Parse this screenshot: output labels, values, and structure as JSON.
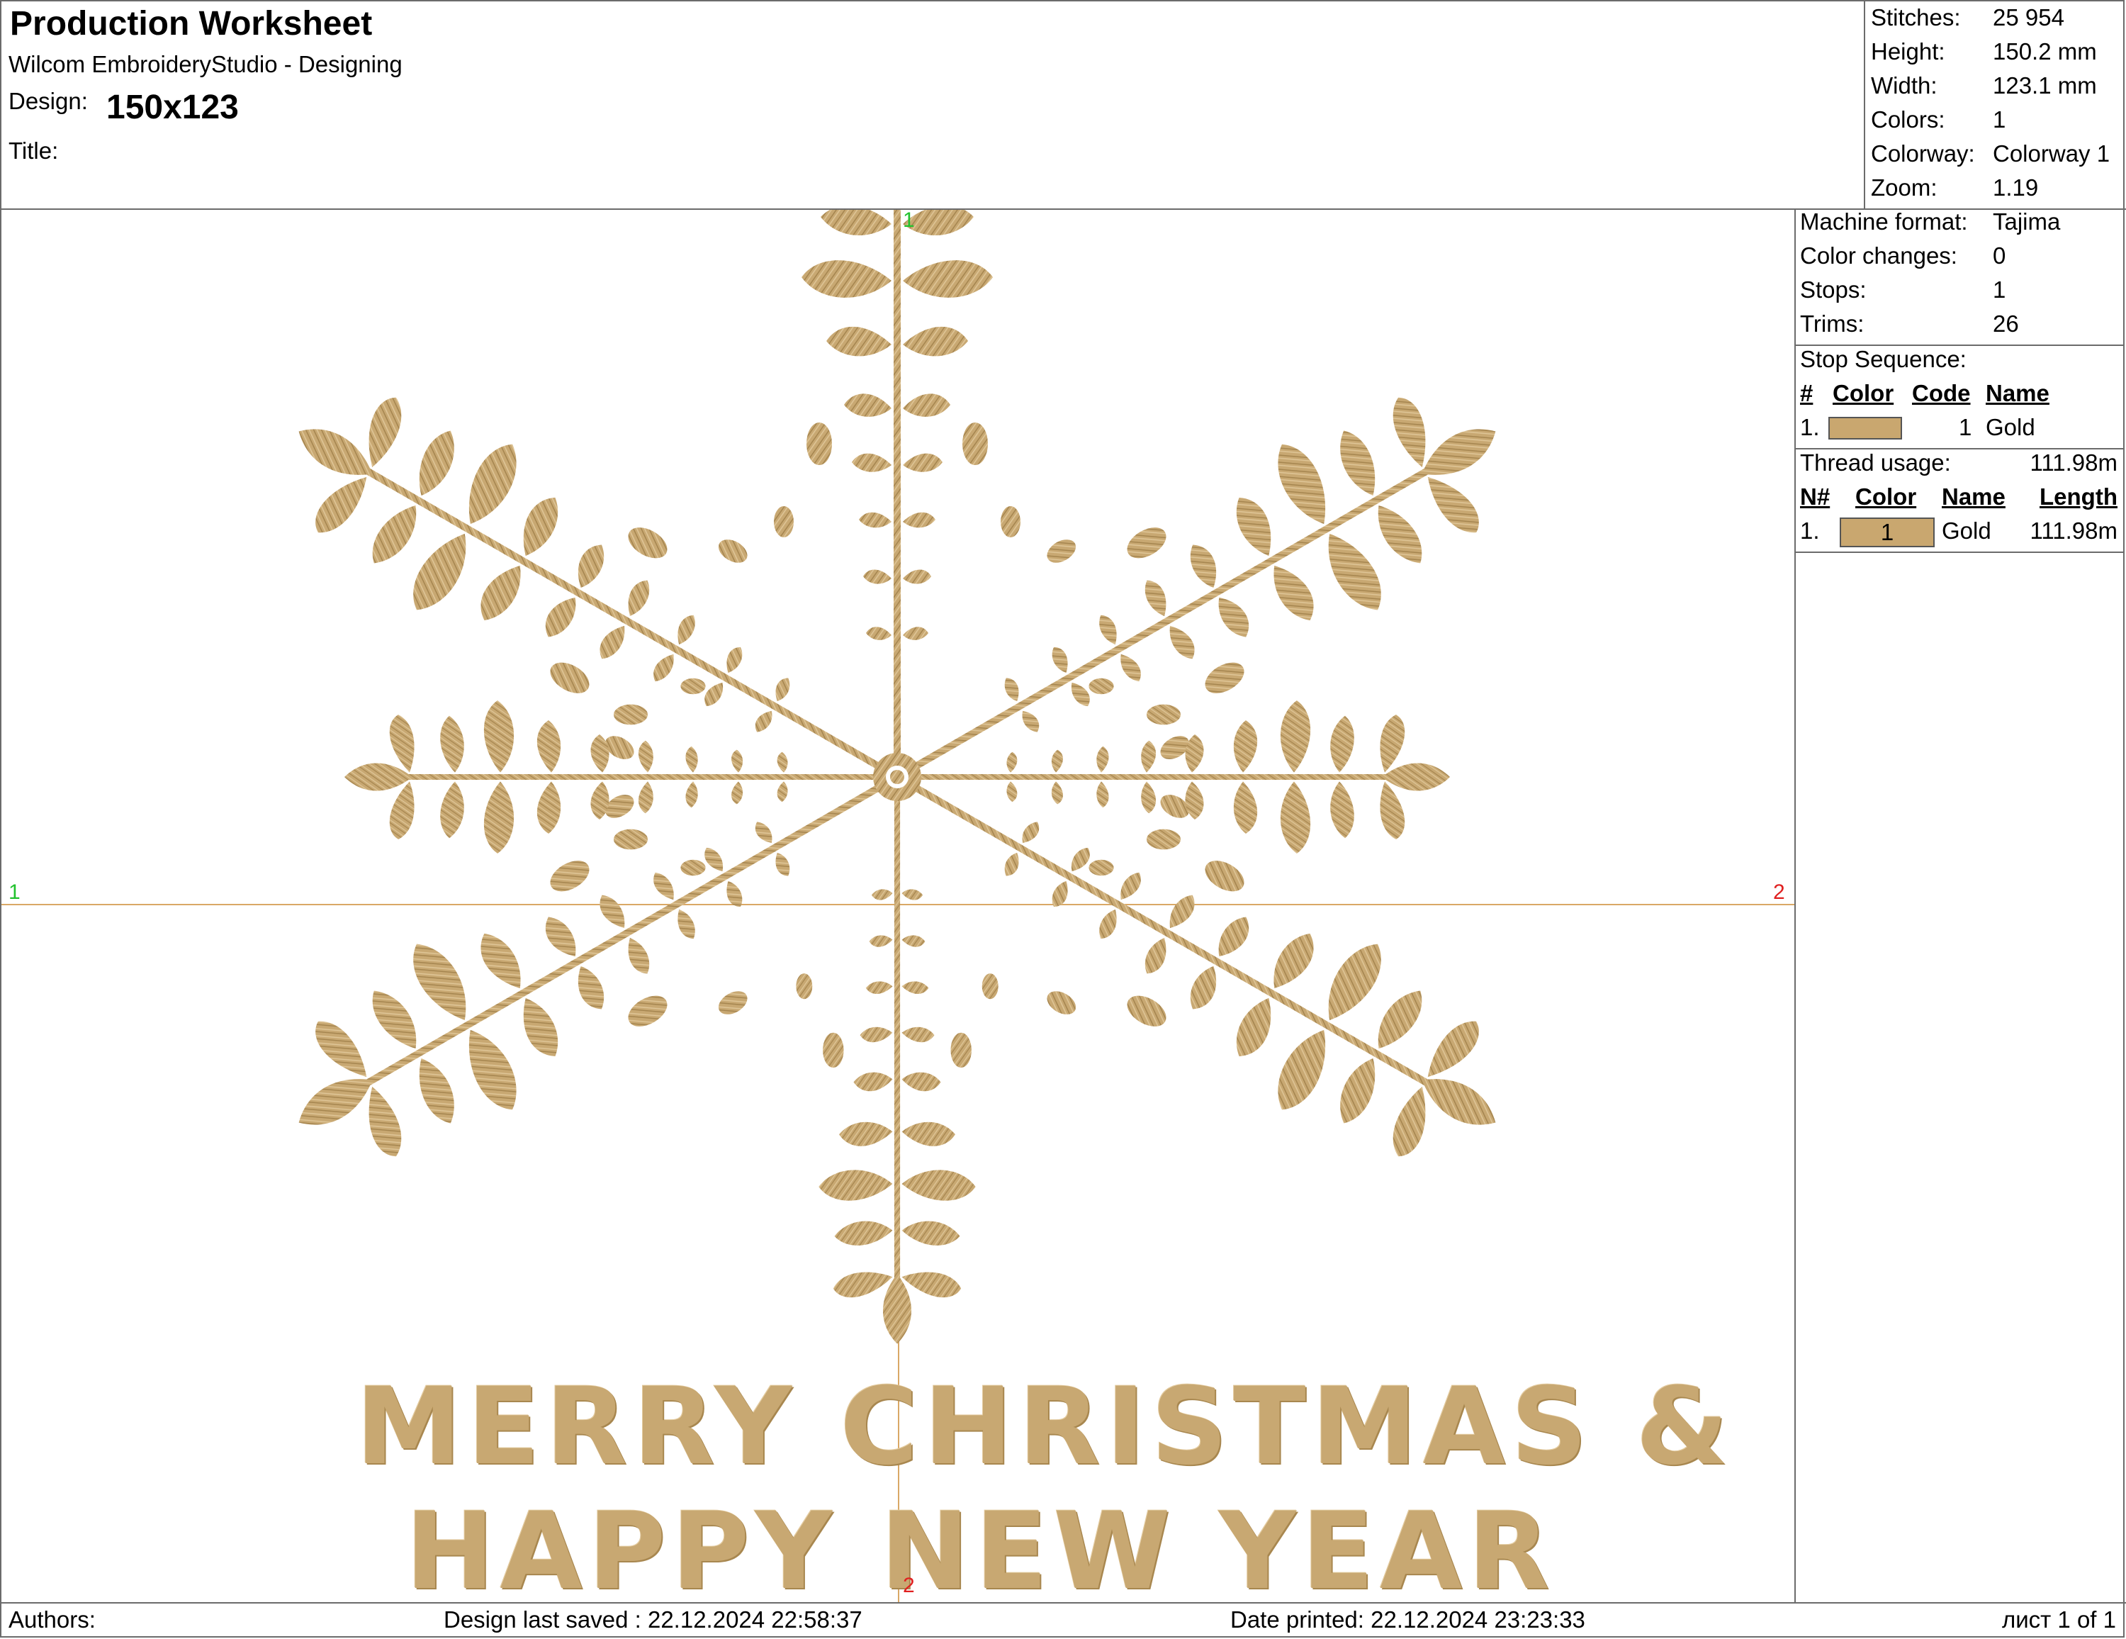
{
  "header": {
    "title": "Production Worksheet",
    "app": "Wilcom EmbroideryStudio - Designing",
    "design_label": "Design:",
    "design_value": "150x123",
    "title_label": "Title:"
  },
  "stats": [
    {
      "label": "Stitches:",
      "value": "25 954"
    },
    {
      "label": "Height:",
      "value": "150.2 mm"
    },
    {
      "label": "Width:",
      "value": "123.1 mm"
    },
    {
      "label": "Colors:",
      "value": "1"
    },
    {
      "label": "Colorway:",
      "value": "Colorway 1"
    },
    {
      "label": "Zoom:",
      "value": "1.19"
    }
  ],
  "machine": [
    {
      "label": "Machine format:",
      "value": "Tajima"
    },
    {
      "label": "Color changes:",
      "value": "0"
    },
    {
      "label": "Stops:",
      "value": "1"
    },
    {
      "label": "Trims:",
      "value": "26"
    }
  ],
  "stop_sequence": {
    "title": "Stop Sequence:",
    "headers": {
      "num": "#",
      "color": "Color",
      "code": "Code",
      "name": "Name"
    },
    "rows": [
      {
        "num": "1.",
        "code": "1",
        "name": "Gold",
        "swatch": "#c9a76f"
      }
    ]
  },
  "thread_usage": {
    "label": "Thread usage:",
    "value": "111.98m",
    "headers": {
      "num": "N#",
      "color": "Color",
      "name": "Name",
      "length": "Length"
    },
    "rows": [
      {
        "num": "1.",
        "color_code": "1",
        "name": "Gold",
        "length": "111.98m",
        "swatch": "#c9a76f"
      }
    ]
  },
  "canvas": {
    "greeting_line1": "MERRY CHRISTMAS &",
    "greeting_line2": "HAPPY NEW YEAR",
    "marker_top": "1",
    "marker_left": "1",
    "marker_right": "2",
    "marker_bottom": "2",
    "thread_color": "#c8a872",
    "guide_color": "#d9a866"
  },
  "footer": {
    "authors_label": "Authors:",
    "last_saved": "Design last saved : 22.12.2024 22:58:37",
    "printed": "Date printed: 22.12.2024 23:23:33",
    "page": "лист 1 of 1"
  }
}
